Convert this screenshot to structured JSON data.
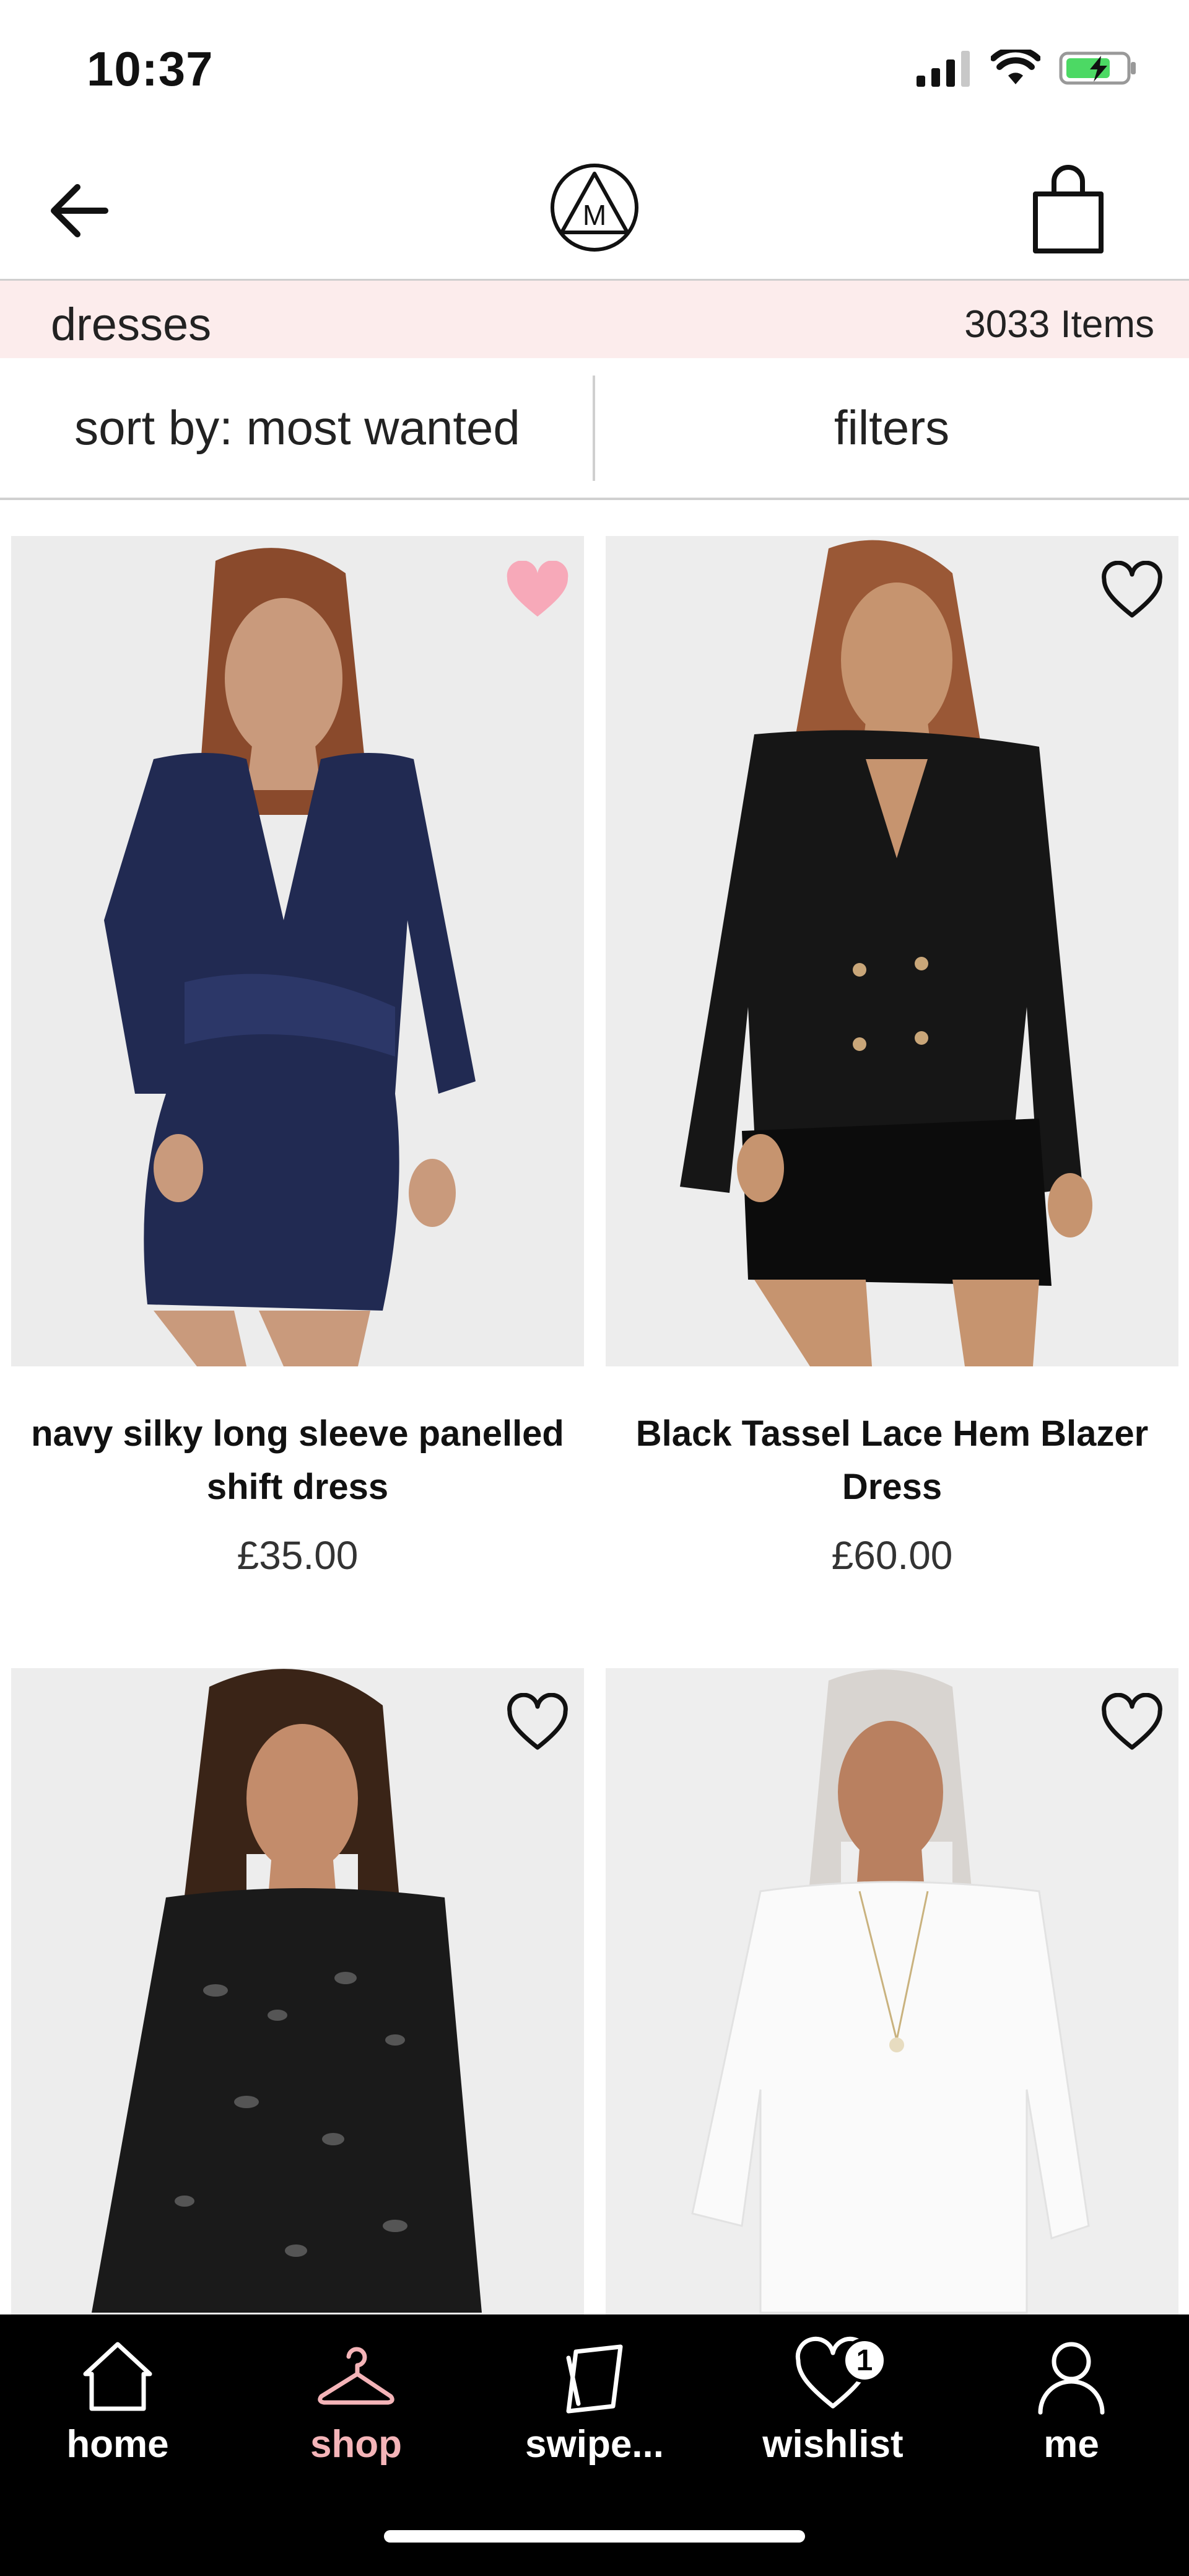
{
  "status_bar": {
    "time": "10:37"
  },
  "header": {
    "logo_letter": "M"
  },
  "category": {
    "name": "dresses",
    "count": "3033 Items"
  },
  "controls": {
    "sort_label": "sort by: most wanted",
    "filters_label": "filters"
  },
  "products": [
    {
      "name": "navy silky long sleeve panelled shift dress",
      "price": "£35.00",
      "wishlisted": true
    },
    {
      "name": "Black Tassel Lace Hem Blazer Dress",
      "price": "£60.00",
      "wishlisted": false
    },
    {
      "name": "",
      "price": "",
      "wishlisted": false
    },
    {
      "name": "",
      "price": "",
      "wishlisted": false
    }
  ],
  "tabs": [
    {
      "label": "home",
      "icon": "house-icon"
    },
    {
      "label": "shop",
      "icon": "hanger-icon",
      "active": true
    },
    {
      "label": "swipe...",
      "icon": "cards-icon"
    },
    {
      "label": "wishlist",
      "icon": "heart-icon",
      "badge": "1"
    },
    {
      "label": "me",
      "icon": "person-icon"
    }
  ],
  "colors": {
    "category_bg": "#fcecec",
    "wishlist_active": "#f7a9b9",
    "tab_active": "#f4b4b8",
    "tab_bar_bg": "#000000"
  }
}
